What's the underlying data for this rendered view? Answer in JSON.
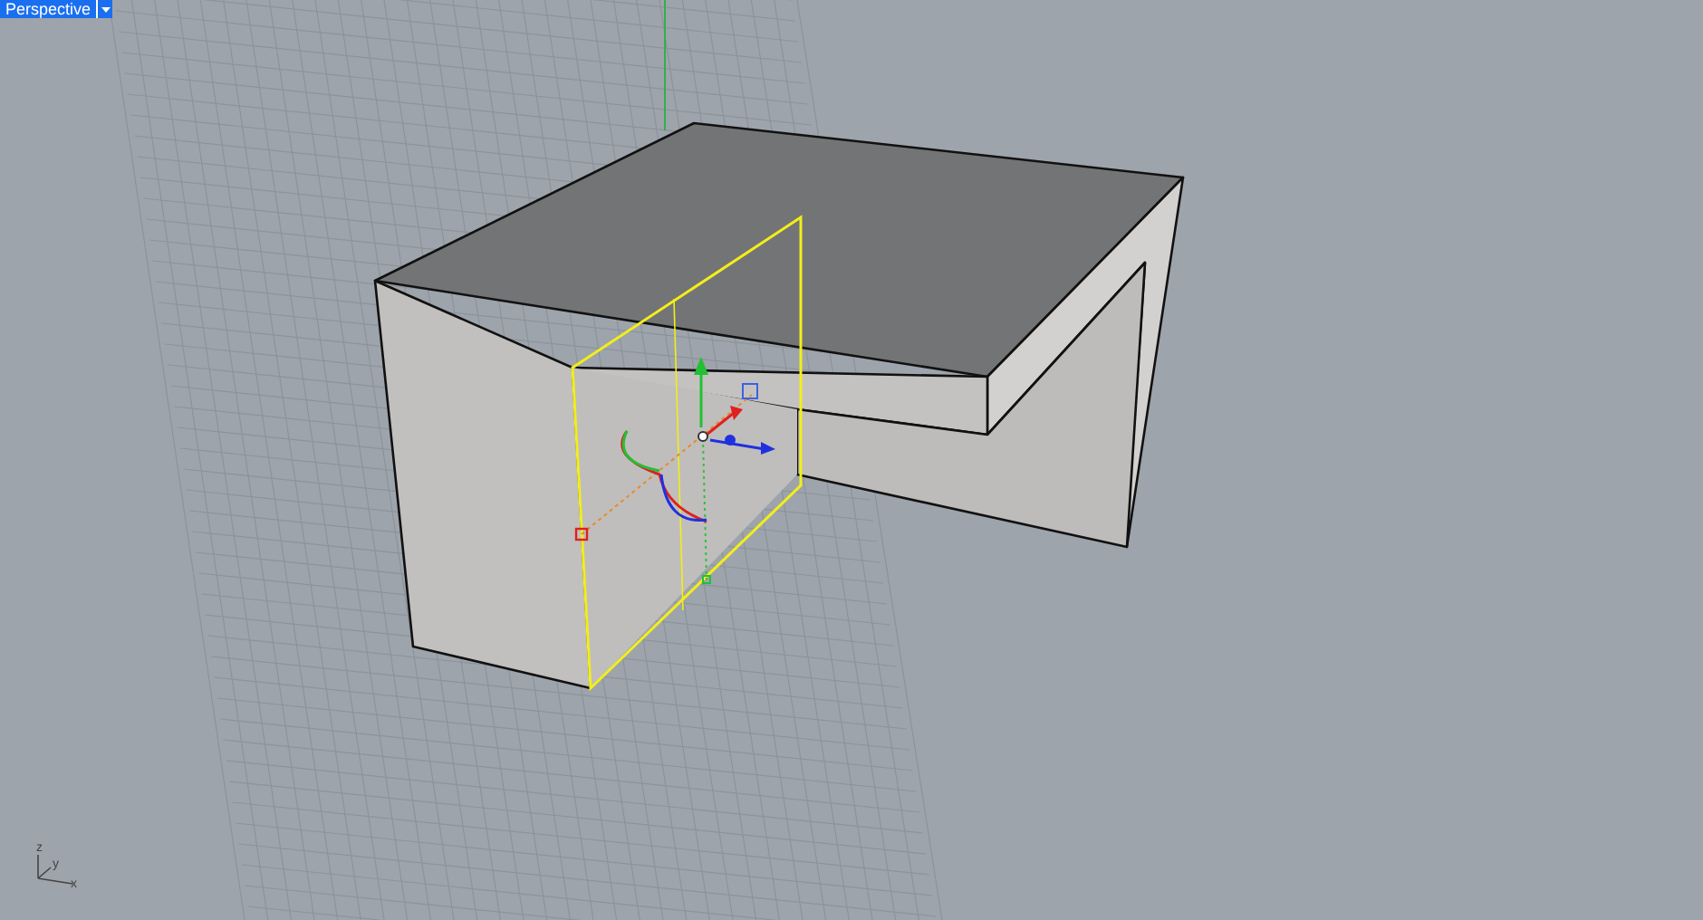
{
  "viewport": {
    "title": "Perspective"
  },
  "axes": {
    "x_label": "x",
    "y_label": "y",
    "z_label": "z"
  }
}
